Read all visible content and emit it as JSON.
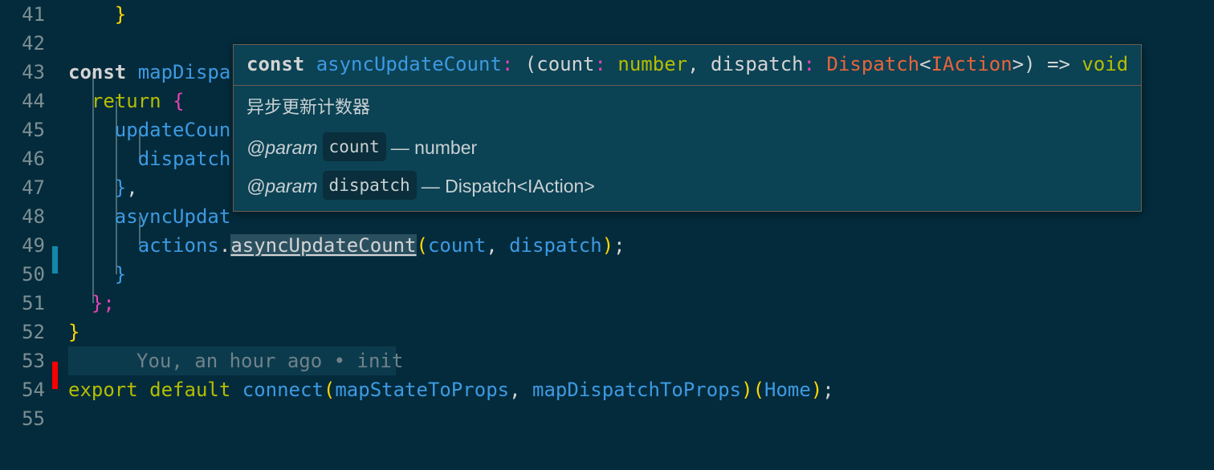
{
  "editor": {
    "background": "#042b3c",
    "font_size_px": 24,
    "lines": [
      {
        "number": "41",
        "marker": "none",
        "tokens": [
          {
            "t": "    ",
            "c": "punct"
          },
          {
            "t": "}",
            "c": "brk-y"
          }
        ]
      },
      {
        "number": "42",
        "marker": "none",
        "tokens": []
      },
      {
        "number": "43",
        "marker": "none",
        "tokens": [
          {
            "t": "const ",
            "c": "kw"
          },
          {
            "t": "mapDispa",
            "c": "fn"
          }
        ]
      },
      {
        "number": "44",
        "marker": "none",
        "tokens": [
          {
            "t": "  ",
            "c": "punct"
          },
          {
            "t": "return ",
            "c": "kwy"
          },
          {
            "t": "{",
            "c": "brk-m"
          }
        ]
      },
      {
        "number": "45",
        "marker": "none",
        "tokens": [
          {
            "t": "    ",
            "c": "punct"
          },
          {
            "t": "updateCoun",
            "c": "fn"
          }
        ]
      },
      {
        "number": "46",
        "marker": "none",
        "tokens": [
          {
            "t": "      ",
            "c": "punct"
          },
          {
            "t": "dispatch",
            "c": "fn"
          }
        ]
      },
      {
        "number": "47",
        "marker": "none",
        "tokens": [
          {
            "t": "    ",
            "c": "punct"
          },
          {
            "t": "}",
            "c": "brk-b"
          },
          {
            "t": ",",
            "c": "punct"
          }
        ]
      },
      {
        "number": "48",
        "marker": "none",
        "tokens": [
          {
            "t": "    ",
            "c": "punct"
          },
          {
            "t": "asyncUpdat",
            "c": "fn"
          }
        ]
      },
      {
        "number": "49",
        "marker": "cyan",
        "tokens": [
          {
            "t": "      ",
            "c": "punct"
          },
          {
            "t": "actions",
            "c": "fn"
          },
          {
            "t": ".",
            "c": "punct"
          },
          {
            "t": "asyncUpdateCount",
            "c": "ref"
          },
          {
            "t": "(",
            "c": "brk-y"
          },
          {
            "t": "count",
            "c": "fn"
          },
          {
            "t": ", ",
            "c": "punct"
          },
          {
            "t": "dispatch",
            "c": "fn"
          },
          {
            "t": ")",
            "c": "brk-y"
          },
          {
            "t": ";",
            "c": "punct"
          }
        ]
      },
      {
        "number": "50",
        "marker": "none",
        "tokens": [
          {
            "t": "    ",
            "c": "punct"
          },
          {
            "t": "}",
            "c": "brk-b"
          }
        ]
      },
      {
        "number": "51",
        "marker": "none",
        "tokens": [
          {
            "t": "  ",
            "c": "punct"
          },
          {
            "t": "}",
            "c": "brk-m"
          },
          {
            "t": ";",
            "c": "brk-m"
          }
        ]
      },
      {
        "number": "52",
        "marker": "none",
        "tokens": [
          {
            "t": "}",
            "c": "brk-y"
          }
        ]
      },
      {
        "number": "53",
        "marker": "red",
        "blame": "You, an hour ago • init",
        "tokens": []
      },
      {
        "number": "54",
        "marker": "none",
        "tokens": [
          {
            "t": "export ",
            "c": "kwy"
          },
          {
            "t": "default ",
            "c": "kwy"
          },
          {
            "t": "connect",
            "c": "fn"
          },
          {
            "t": "(",
            "c": "brk-y"
          },
          {
            "t": "mapStateToProps",
            "c": "fn"
          },
          {
            "t": ", ",
            "c": "punct"
          },
          {
            "t": "mapDispatchToProps",
            "c": "fn"
          },
          {
            "t": ")",
            "c": "brk-y"
          },
          {
            "t": "(",
            "c": "brk-y"
          },
          {
            "t": "Home",
            "c": "fn"
          },
          {
            "t": ")",
            "c": "brk-y"
          },
          {
            "t": ";",
            "c": "punct"
          }
        ]
      },
      {
        "number": "55",
        "marker": "none",
        "tokens": []
      }
    ]
  },
  "tooltip": {
    "signature": [
      {
        "t": "const ",
        "c": "kw"
      },
      {
        "t": "asyncUpdateCount",
        "c": "fn"
      },
      {
        "t": ":",
        "c": "brk-m"
      },
      {
        "t": " (",
        "c": "punct"
      },
      {
        "t": "count",
        "c": "punct"
      },
      {
        "t": ":",
        "c": "brk-m"
      },
      {
        "t": " ",
        "c": "punct"
      },
      {
        "t": "number",
        "c": "num"
      },
      {
        "t": ", ",
        "c": "punct"
      },
      {
        "t": "dispatch",
        "c": "punct"
      },
      {
        "t": ":",
        "c": "brk-m"
      },
      {
        "t": " ",
        "c": "punct"
      },
      {
        "t": "Dispatch",
        "c": "type"
      },
      {
        "t": "<",
        "c": "punct"
      },
      {
        "t": "IAction",
        "c": "type"
      },
      {
        "t": ">",
        "c": "punct"
      },
      {
        "t": ")",
        "c": "punct"
      },
      {
        "t": " => ",
        "c": "punct"
      },
      {
        "t": "void",
        "c": "num"
      }
    ],
    "signature_text": "const asyncUpdateCount: (count: number, dispatch: Dispatch<IAction>) => void",
    "description": "异步更新计数器",
    "params": [
      {
        "tag": "@param",
        "name": "count",
        "dash": "—",
        "type": "number"
      },
      {
        "tag": "@param",
        "name": "dispatch",
        "dash": "—",
        "type": "Dispatch<IAction>"
      }
    ],
    "border_color": "#6b5f52",
    "background": "#0b4254"
  },
  "colors": {
    "editor_bg": "#042b3c",
    "cursor_red": "#fb0000",
    "reference_cyan": "#1289ac",
    "line_number": "#7d8f93",
    "blame_text": "#6f8289"
  }
}
